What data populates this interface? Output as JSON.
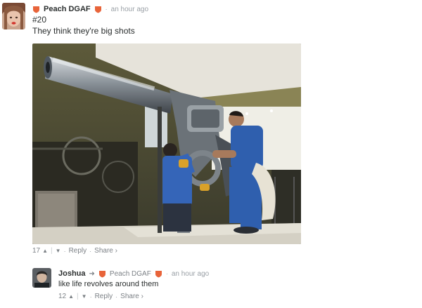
{
  "comment": {
    "author": "Peach DGAF",
    "time": "an hour ago",
    "text_line1": "#20",
    "text_line2": "They think they're big shots",
    "votes": "17",
    "reply_label": "Reply",
    "share_label": "Share ›"
  },
  "reply": {
    "author": "Joshua",
    "reply_to": "Peach DGAF",
    "time": "an hour ago",
    "text": "like life revolves around them",
    "votes": "12",
    "reply_label": "Reply",
    "share_label": "Share ›"
  },
  "colors": {
    "badge": "#e8643a",
    "muted": "#7d8287",
    "text": "#2a2e2e"
  }
}
